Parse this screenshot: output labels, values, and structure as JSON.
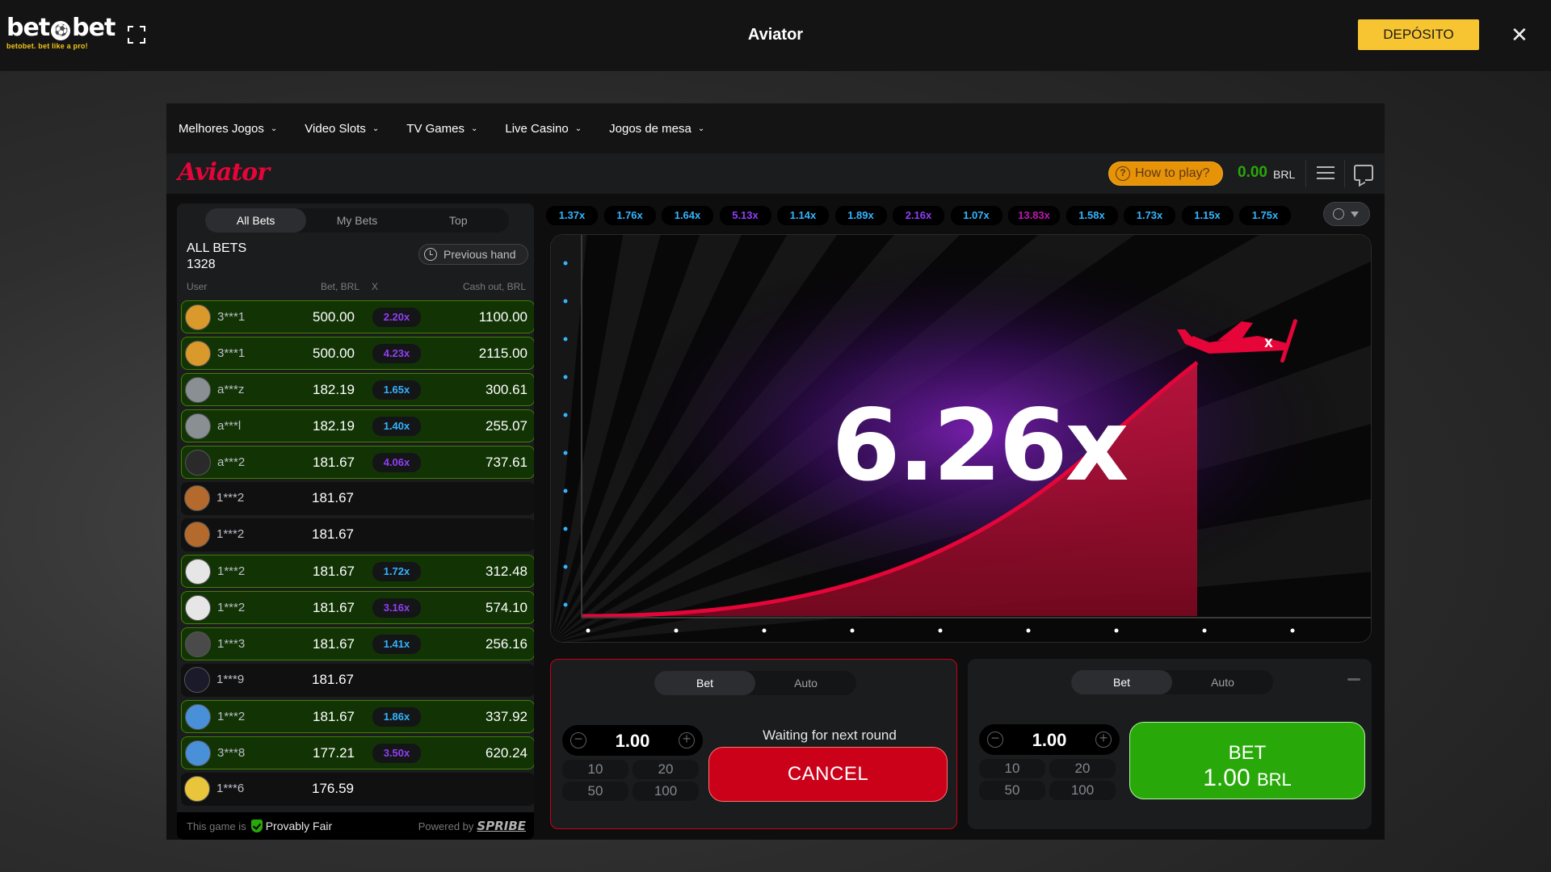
{
  "topbar": {
    "logo_text": "bet●bet",
    "logo_tagline": "betobet. bet like a pro!",
    "title": "Aviator",
    "deposit_label": "DEPÓSITO"
  },
  "nav": {
    "items": [
      {
        "label": "Melhores Jogos"
      },
      {
        "label": "Video Slots"
      },
      {
        "label": "TV Games"
      },
      {
        "label": "Live Casino"
      },
      {
        "label": "Jogos de mesa"
      }
    ]
  },
  "game_header": {
    "logo": "Aviator",
    "how_to_play": "How to play?",
    "balance": "0.00",
    "currency": "BRL"
  },
  "bets_panel": {
    "tabs": [
      {
        "label": "All Bets",
        "active": true
      },
      {
        "label": "My Bets",
        "active": false
      },
      {
        "label": "Top",
        "active": false
      }
    ],
    "title": "ALL BETS",
    "count": "1328",
    "previous_hand": "Previous hand",
    "columns": {
      "user": "User",
      "bet": "Bet, BRL",
      "x": "X",
      "cashout": "Cash out, BRL"
    },
    "rows": [
      {
        "user": "3***1",
        "bet": "500.00",
        "mult": "2.20x",
        "cashout": "1100.00",
        "won": true,
        "mult_color": "#913ef8",
        "avatar": "#d99a2b"
      },
      {
        "user": "3***1",
        "bet": "500.00",
        "mult": "4.23x",
        "cashout": "2115.00",
        "won": true,
        "mult_color": "#913ef8",
        "avatar": "#d99a2b"
      },
      {
        "user": "a***z",
        "bet": "182.19",
        "mult": "1.65x",
        "cashout": "300.61",
        "won": true,
        "mult_color": "#34b4ff",
        "avatar": "#8a8f94"
      },
      {
        "user": "a***l",
        "bet": "182.19",
        "mult": "1.40x",
        "cashout": "255.07",
        "won": true,
        "mult_color": "#34b4ff",
        "avatar": "#8a8f94"
      },
      {
        "user": "a***2",
        "bet": "181.67",
        "mult": "4.06x",
        "cashout": "737.61",
        "won": true,
        "mult_color": "#913ef8",
        "avatar": "#2a2a2a"
      },
      {
        "user": "1***2",
        "bet": "181.67",
        "mult": "",
        "cashout": "",
        "won": false,
        "mult_color": "",
        "avatar": "#b46a2c"
      },
      {
        "user": "1***2",
        "bet": "181.67",
        "mult": "",
        "cashout": "",
        "won": false,
        "mult_color": "",
        "avatar": "#b46a2c"
      },
      {
        "user": "1***2",
        "bet": "181.67",
        "mult": "1.72x",
        "cashout": "312.48",
        "won": true,
        "mult_color": "#34b4ff",
        "avatar": "#e6e6e6"
      },
      {
        "user": "1***2",
        "bet": "181.67",
        "mult": "3.16x",
        "cashout": "574.10",
        "won": true,
        "mult_color": "#913ef8",
        "avatar": "#e6e6e6"
      },
      {
        "user": "1***3",
        "bet": "181.67",
        "mult": "1.41x",
        "cashout": "256.16",
        "won": true,
        "mult_color": "#34b4ff",
        "avatar": "#4a4a4a"
      },
      {
        "user": "1***9",
        "bet": "181.67",
        "mult": "",
        "cashout": "",
        "won": false,
        "mult_color": "",
        "avatar": "#1a1a2a"
      },
      {
        "user": "1***2",
        "bet": "181.67",
        "mult": "1.86x",
        "cashout": "337.92",
        "won": true,
        "mult_color": "#34b4ff",
        "avatar": "#4a90d9"
      },
      {
        "user": "3***8",
        "bet": "177.21",
        "mult": "3.50x",
        "cashout": "620.24",
        "won": true,
        "mult_color": "#913ef8",
        "avatar": "#4a90d9"
      },
      {
        "user": "1***6",
        "bet": "176.59",
        "mult": "",
        "cashout": "",
        "won": false,
        "mult_color": "",
        "avatar": "#e8c53a"
      }
    ],
    "footer": {
      "text": "This game is",
      "fair": "Provably Fair",
      "powered": "Powered by",
      "brand": "SPRIBE"
    }
  },
  "history": [
    {
      "value": "1.37x",
      "color": "#34b4ff"
    },
    {
      "value": "1.76x",
      "color": "#34b4ff"
    },
    {
      "value": "1.64x",
      "color": "#34b4ff"
    },
    {
      "value": "5.13x",
      "color": "#913ef8"
    },
    {
      "value": "1.14x",
      "color": "#34b4ff"
    },
    {
      "value": "1.89x",
      "color": "#34b4ff"
    },
    {
      "value": "2.16x",
      "color": "#913ef8"
    },
    {
      "value": "1.07x",
      "color": "#34b4ff"
    },
    {
      "value": "13.83x",
      "color": "#c017b4"
    },
    {
      "value": "1.58x",
      "color": "#34b4ff"
    },
    {
      "value": "1.73x",
      "color": "#34b4ff"
    },
    {
      "value": "1.15x",
      "color": "#34b4ff"
    },
    {
      "value": "1.75x",
      "color": "#34b4ff"
    }
  ],
  "game": {
    "multiplier": "6.26x"
  },
  "bet_left": {
    "tabs": [
      {
        "label": "Bet",
        "active": true
      },
      {
        "label": "Auto",
        "active": false
      }
    ],
    "amount": "1.00",
    "presets": [
      "10",
      "20",
      "50",
      "100"
    ],
    "waiting": "Waiting for next round",
    "cancel_label": "CANCEL"
  },
  "bet_right": {
    "tabs": [
      {
        "label": "Bet",
        "active": true
      },
      {
        "label": "Auto",
        "active": false
      }
    ],
    "amount": "1.00",
    "presets": [
      "10",
      "20",
      "50",
      "100"
    ],
    "bet_label": "BET",
    "bet_amount": "1.00",
    "bet_currency": "BRL"
  },
  "colors": {
    "accent_red": "#e50539",
    "win_green": "#28a909",
    "deposit_yellow": "#f7c531"
  }
}
